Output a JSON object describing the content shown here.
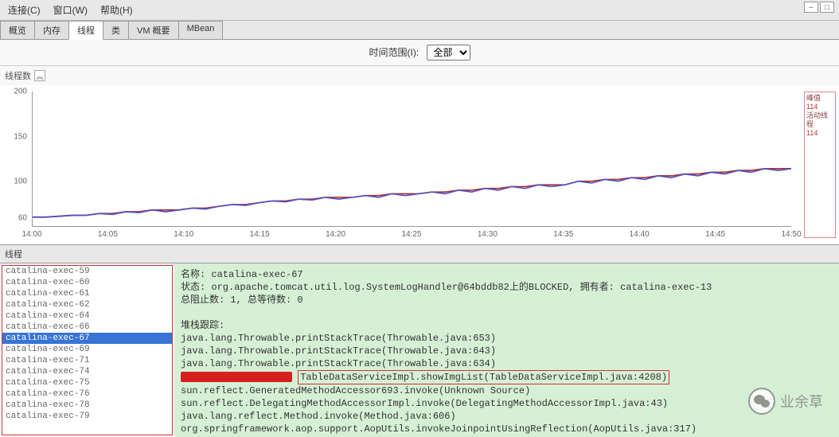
{
  "menubar": {
    "connect": "连接(C)",
    "window": "窗口(W)",
    "help": "帮助(H)"
  },
  "tabs": [
    "概览",
    "内存",
    "线程",
    "类",
    "VM 概要",
    "MBean"
  ],
  "active_tab": 2,
  "filter": {
    "label": "时间范围(I):",
    "selected": "全部",
    "options": [
      "全部"
    ]
  },
  "thread_count_label": "线程数",
  "chart_data": {
    "type": "line",
    "title": "",
    "ylabel": "",
    "xlabel": "",
    "ylim": [
      50,
      200
    ],
    "yticks": [
      60,
      100,
      150,
      200
    ],
    "xticks": [
      "14:00",
      "14:05",
      "14:10",
      "14:15",
      "14:20",
      "14:25",
      "14:30",
      "14:35",
      "14:40",
      "14:45",
      "14:50"
    ],
    "series": [
      {
        "name": "峰值",
        "color": "#b03030",
        "values": [
          60,
          60,
          61,
          62,
          62,
          64,
          64,
          66,
          66,
          68,
          68,
          68,
          70,
          70,
          72,
          74,
          74,
          76,
          78,
          78,
          80,
          80,
          82,
          82,
          82,
          84,
          84,
          86,
          86,
          86,
          88,
          88,
          90,
          90,
          92,
          92,
          94,
          94,
          96,
          96,
          96,
          100,
          100,
          102,
          102,
          104,
          104,
          106,
          106,
          108,
          108,
          110,
          110,
          112,
          112,
          114,
          114,
          114
        ]
      },
      {
        "name": "活动线程",
        "color": "#5050c0",
        "values": [
          60,
          60,
          61,
          62,
          62,
          64,
          63,
          66,
          65,
          68,
          66,
          68,
          70,
          69,
          72,
          74,
          73,
          76,
          78,
          77,
          80,
          79,
          82,
          80,
          82,
          84,
          82,
          86,
          84,
          86,
          88,
          86,
          90,
          88,
          92,
          90,
          94,
          92,
          96,
          94,
          96,
          100,
          98,
          102,
          100,
          104,
          102,
          106,
          104,
          108,
          106,
          110,
          108,
          112,
          110,
          114,
          112,
          114
        ]
      }
    ],
    "legend": {
      "line1": "峰值",
      "v1": "114",
      "line2": "活动线程",
      "v2": "114"
    }
  },
  "section_title": "线程",
  "thread_list": [
    "catalina-exec-59",
    "catalina-exec-60",
    "catalina-exec-61",
    "catalina-exec-62",
    "catalina-exec-64",
    "catalina-exec-66",
    "catalina-exec-67",
    "catalina-exec-69",
    "catalina-exec-71",
    "catalina-exec-74",
    "catalina-exec-75",
    "catalina-exec-76",
    "catalina-exec-78",
    "catalina-exec-79"
  ],
  "selected_thread": "catalina-exec-67",
  "detail": {
    "name_label": "名称:",
    "name": "catalina-exec-67",
    "state_label": "状态:",
    "state": "org.apache.tomcat.util.log.SystemLogHandler@64bddb82上的BLOCKED, 拥有者: catalina-exec-13",
    "block_label": "总阻止数:",
    "block_val": "1, 总等待数: 0",
    "stack_label": "堆栈跟踪:",
    "stack": [
      "java.lang.Throwable.printStackTrace(Throwable.java:653)",
      "java.lang.Throwable.printStackTrace(Throwable.java:643)",
      "java.lang.Throwable.printStackTrace(Throwable.java:634)"
    ],
    "highlight_line": "TableDataServiceImpl.showImgList(TableDataServiceImpl.java:4208)",
    "stack2": [
      "sun.reflect.GeneratedMethodAccessor693.invoke(Unknown Source)",
      "sun.reflect.DelegatingMethodAccessorImpl.invoke(DelegatingMethodAccessorImpl.java:43)",
      "java.lang.reflect.Method.invoke(Method.java:606)",
      "org.springframework.aop.support.AopUtils.invokeJoinpointUsingReflection(AopUtils.java:317)"
    ]
  },
  "watermark": "业余草"
}
